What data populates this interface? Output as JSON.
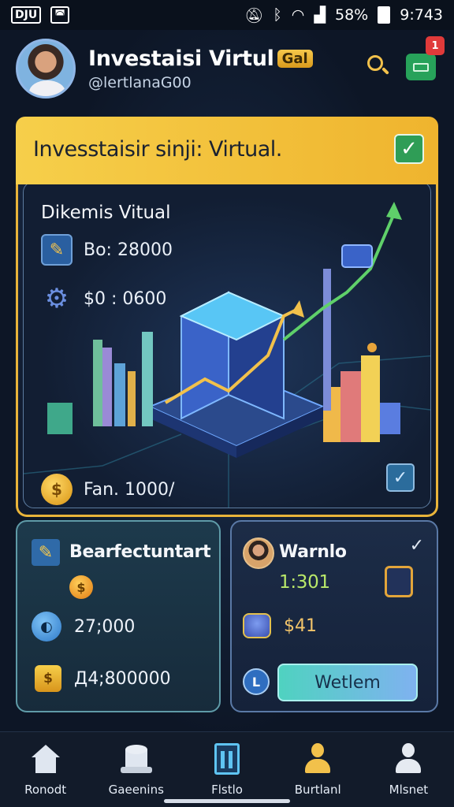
{
  "status_bar": {
    "left_badge": "DJU",
    "time": "9:743",
    "battery": "58%"
  },
  "header": {
    "title": "Investaisi Virtul",
    "title_badge": "Gal",
    "handle": "@lertlanaG00",
    "notification_count": "1"
  },
  "banner": {
    "title": "Invesstaisir sinji: Virtual."
  },
  "main_card": {
    "heading": "Dikemis Vitual",
    "stats": [
      {
        "icon": "pencil-icon",
        "label": "Bo: 28000"
      },
      {
        "icon": "gear-icon",
        "label": "$0 : 0600"
      },
      {
        "icon": "coin-icon",
        "label": "Fan. 1000/"
      }
    ]
  },
  "left_card": {
    "title": "Bearfectuntart",
    "value_1": "27;000",
    "value_2": "Д4;800000"
  },
  "right_card": {
    "title": "Warnlo",
    "subvalue": "1:301",
    "amount": "$41",
    "button_label": "Wetlem"
  },
  "nav": {
    "items": [
      {
        "label": "Ronodt",
        "icon": "home-icon"
      },
      {
        "label": "Gaeenins",
        "icon": "cylinder-icon"
      },
      {
        "label": "Flstlo",
        "icon": "portfolio-icon"
      },
      {
        "label": "Burtlanl",
        "icon": "user-gold-icon"
      },
      {
        "label": "Mlsnet",
        "icon": "user-white-icon"
      }
    ]
  },
  "colors": {
    "accent_gold": "#f2c14b",
    "accent_green": "#2f9d56",
    "background": "#0d1626",
    "card_teal": "#1d3a4c"
  }
}
